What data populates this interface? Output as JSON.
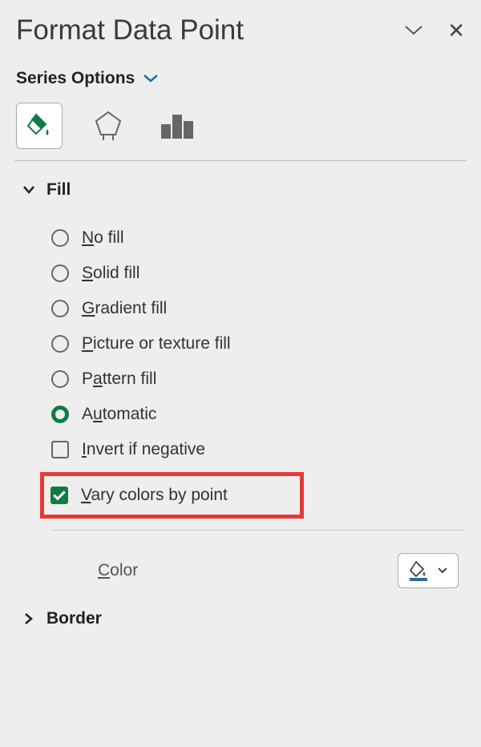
{
  "header": {
    "title": "Format Data Point"
  },
  "dropdown": {
    "label": "Series Options"
  },
  "sections": {
    "fill": {
      "title": "Fill",
      "options": {
        "nofill": "No fill",
        "solid": "Solid fill",
        "gradient": "Gradient fill",
        "picture": "Picture or texture fill",
        "pattern": "Pattern fill",
        "automatic": "Automatic",
        "invert": "Invert if negative",
        "vary": "Vary colors by point"
      },
      "color_label": "Color"
    },
    "border": {
      "title": "Border"
    }
  }
}
